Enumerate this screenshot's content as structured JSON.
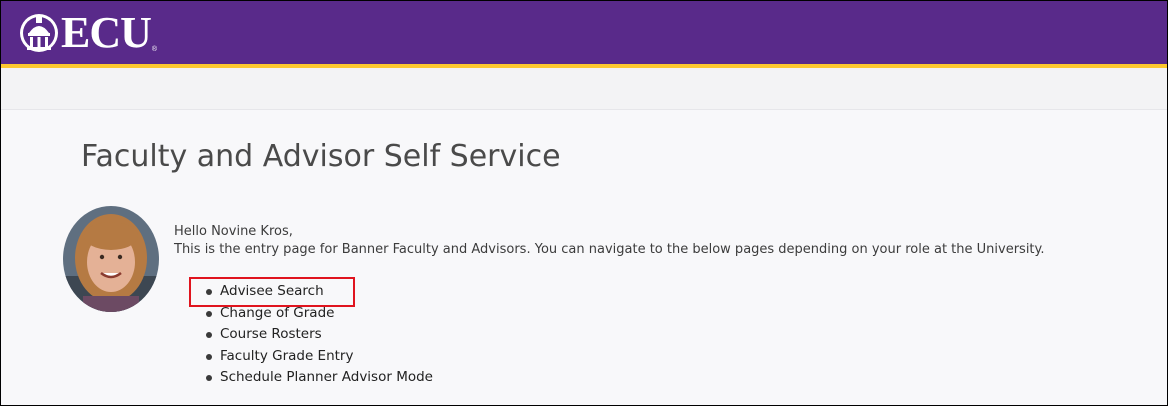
{
  "header": {
    "logo_text": "ECU",
    "logo_icon": "ecu-cupola-icon",
    "logo_reg": "®",
    "brand_color": "#592a8a",
    "accent_color": "#fdc82f"
  },
  "page": {
    "title": "Faculty and Advisor Self Service",
    "greeting": "Hello Novine Kros,",
    "description": "This is the entry page for Banner Faculty and Advisors. You can navigate to the below pages depending on your role at the University."
  },
  "nav_links": [
    {
      "label": "Advisee Search"
    },
    {
      "label": "Change of Grade"
    },
    {
      "label": "Course Rosters"
    },
    {
      "label": "Faculty Grade Entry"
    },
    {
      "label": "Schedule Planner Advisor Mode"
    }
  ],
  "annotation": {
    "highlight_color": "#e0141e"
  }
}
